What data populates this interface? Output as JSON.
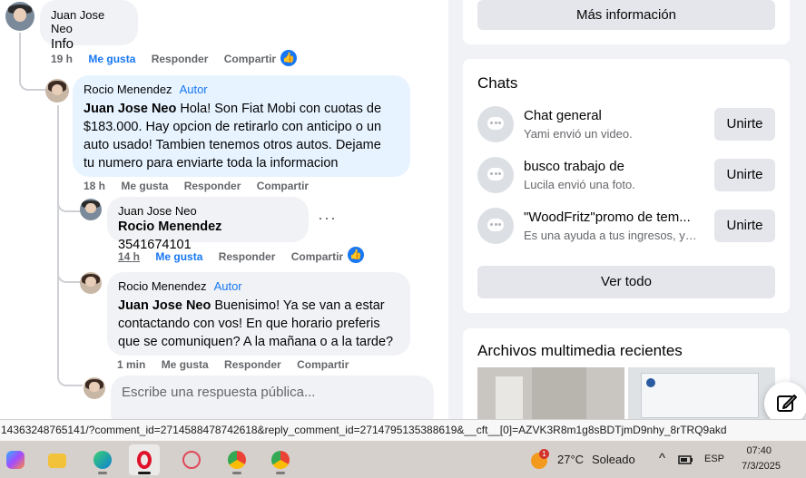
{
  "comments": {
    "c1": {
      "author": "Juan Jose Neo",
      "text": "Info",
      "time": "19 h",
      "like": "Me gusta",
      "reply": "Responder",
      "share": "Compartir"
    },
    "c2": {
      "author": "Rocio Menendez",
      "tag": "Autor",
      "mention": "Juan Jose Neo",
      "line1": " Hola! Son Fiat Mobi con cuotas de",
      "line2": "$183.000. Hay opcion de retirarlo con anticipo o un",
      "line3": "auto usado! Tambien tenemos otros autos. Dejame",
      "line4": "tu numero para enviarte toda la informacion",
      "time": "18 h",
      "like": "Me gusta",
      "reply": "Responder",
      "share": "Compartir"
    },
    "c3": {
      "author": "Juan Jose Neo",
      "mention": "Rocio Menendez",
      "text": " 3541674101",
      "time": "14 h",
      "like": "Me gusta",
      "reply": "Responder",
      "share": "Compartir",
      "more": "···"
    },
    "c4": {
      "author": "Rocio Menendez",
      "tag": "Autor",
      "mention": "Juan Jose Neo",
      "line1": " Buenisimo! Ya se van a estar",
      "line2": "contactando con vos! En que horario preferis",
      "line3": "que se comuniquen? A la mañana o a la tarde?",
      "time": "1 min",
      "like": "Me gusta",
      "reply": "Responder",
      "share": "Compartir"
    },
    "reply_placeholder": "Escribe una respuesta pública..."
  },
  "sidebar": {
    "more_info": "Más información",
    "chats_title": "Chats",
    "chats": [
      {
        "title": "Chat general",
        "sub": "Yami envió un video.",
        "button": "Unirte"
      },
      {
        "title": "busco trabajo de",
        "sub": "Lucila envió una foto.",
        "button": "Unirte"
      },
      {
        "title": "\"WoodFritz\"promo de tem...",
        "sub": "Es una ayuda a tus ingresos, yo ...",
        "button": "Unirte"
      }
    ],
    "see_all": "Ver todo",
    "media_title": "Archivos multimedia recientes"
  },
  "status_url": "14363248765141/?comment_id=2714588478742618&reply_comment_id=2714795135388619&__cft__[0]=AZVK3R8m1g8sBDTjmD9nhy_8rTRQ9akd",
  "taskbar": {
    "notification_count": "1",
    "temperature": "27°C",
    "weather": "Soleado",
    "chevron": "^",
    "language": "ESP",
    "time": "07:40",
    "date": "7/3/2025"
  },
  "colors": {
    "accent": "#1877f2",
    "bubble": "#f0f2f5",
    "page_bg": "#f0f2f5"
  }
}
